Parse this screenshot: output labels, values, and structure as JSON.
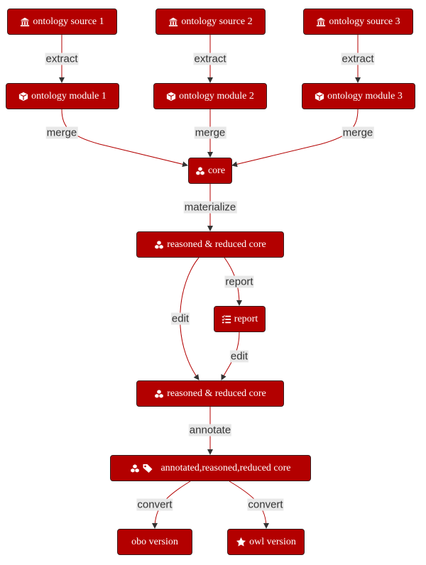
{
  "colors": {
    "node_fill": "#b30000",
    "edge": "#b30000",
    "label_bg": "#e8e8e8",
    "label_text": "#333333"
  },
  "nodes": {
    "src1": {
      "label": "ontology source 1",
      "icon": "landmark-icon"
    },
    "src2": {
      "label": "ontology source 2",
      "icon": "landmark-icon"
    },
    "src3": {
      "label": "ontology source 3",
      "icon": "landmark-icon"
    },
    "mod1": {
      "label": "ontology module 1",
      "icon": "cube-icon"
    },
    "mod2": {
      "label": "ontology module 2",
      "icon": "cube-icon"
    },
    "mod3": {
      "label": "ontology module 3",
      "icon": "cube-icon"
    },
    "core": {
      "label": "core",
      "icon": "cubes-icon"
    },
    "rrc1": {
      "label": "reasoned & reduced core",
      "icon": "cubes-icon"
    },
    "report": {
      "label": "report",
      "icon": "tasks-icon"
    },
    "rrc2": {
      "label": "reasoned & reduced core",
      "icon": "cubes-icon"
    },
    "arc": {
      "label": "annotated,reasoned,reduced core",
      "icon": "cubes-tags-icon"
    },
    "obo": {
      "label": "obo version"
    },
    "owl": {
      "label": "owl version",
      "icon": "star-icon"
    }
  },
  "edges": {
    "extract1": "extract",
    "extract2": "extract",
    "extract3": "extract",
    "merge1": "merge",
    "merge2": "merge",
    "merge3": "merge",
    "materialize": "materialize",
    "report": "report",
    "edit1": "edit",
    "edit2": "edit",
    "annotate": "annotate",
    "convert1": "convert",
    "convert2": "convert"
  }
}
